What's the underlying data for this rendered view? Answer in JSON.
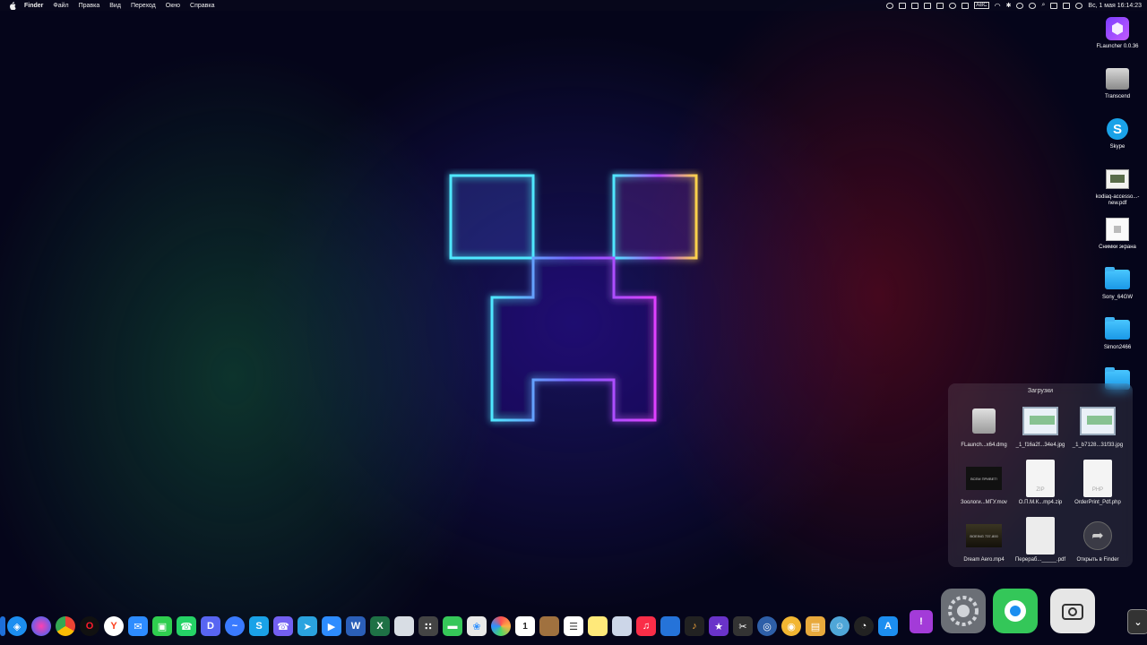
{
  "menubar": {
    "apple_icon": "apple-icon",
    "items": [
      "Finder",
      "Файл",
      "Правка",
      "Вид",
      "Переход",
      "Окно",
      "Справка"
    ],
    "input_source": "ABC",
    "clock": "Вс, 1 мая 16:14:23"
  },
  "desktop_icons": [
    {
      "label": "FLauncher 0.0.36",
      "icon": "flauncher-icon"
    },
    {
      "label": "Transcend",
      "icon": "external-drive-icon"
    },
    {
      "label": "Skype",
      "icon": "skype-icon"
    },
    {
      "label": "kodiaq-accesso...-new.pdf",
      "icon": "pdf-file-icon"
    },
    {
      "label": "Снимки экрана",
      "icon": "screenshots-folder-icon"
    },
    {
      "label": "Sony_64GW",
      "icon": "folder-icon"
    },
    {
      "label": "Simon2466",
      "icon": "folder-icon"
    }
  ],
  "downloads": {
    "title": "Загрузки",
    "items": [
      {
        "label": "FLaunch...x64.dmg",
        "kind": "dmg"
      },
      {
        "label": "_1_f16a2f...34e4.jpg",
        "kind": "certificate"
      },
      {
        "label": "_1_b7128...31f33.jpg",
        "kind": "certificate"
      },
      {
        "label": "Зоологи...МГУ.mov",
        "kind": "video",
        "thumb_text": "ВСЕМ ПРИВЕТ!"
      },
      {
        "label": "О.П.М.К...mp4.zip",
        "kind": "zip",
        "ext": "ZIP"
      },
      {
        "label": "OrderPrint_Pdf.php",
        "kind": "php",
        "ext": "PHP"
      },
      {
        "label": "Dream Aero.mp4",
        "kind": "video",
        "thumb_text": "BOEING 737-800"
      },
      {
        "label": "Перераб..._____.pdf",
        "kind": "pdf"
      },
      {
        "label": "Открыть в Finder",
        "kind": "action"
      }
    ]
  },
  "dock": {
    "apps": [
      "finder",
      "safari",
      "siri",
      "chrome",
      "opera",
      "yandex",
      "mail",
      "facetime",
      "whatsapp",
      "discord",
      "messenger",
      "skype",
      "viber",
      "telegram",
      "zoom",
      "word",
      "excel",
      "notes",
      "calculator",
      "messages",
      "photos",
      "photo-browser",
      "calendar",
      "box",
      "reminders",
      "stickies",
      "display",
      "music",
      "keynote",
      "garageband",
      "imovie",
      "final-cut",
      "network",
      "compass",
      "archive",
      "pet",
      "speed",
      "app-store",
      "feedback",
      "system-preferences",
      "find-my",
      "screenshot",
      "downloads-stack"
    ],
    "calendar_day": "1"
  },
  "colors": {
    "cyan": "#4fe8ff",
    "magenta": "#e040ff",
    "yellow": "#ffd34a",
    "background": "#05051a"
  }
}
